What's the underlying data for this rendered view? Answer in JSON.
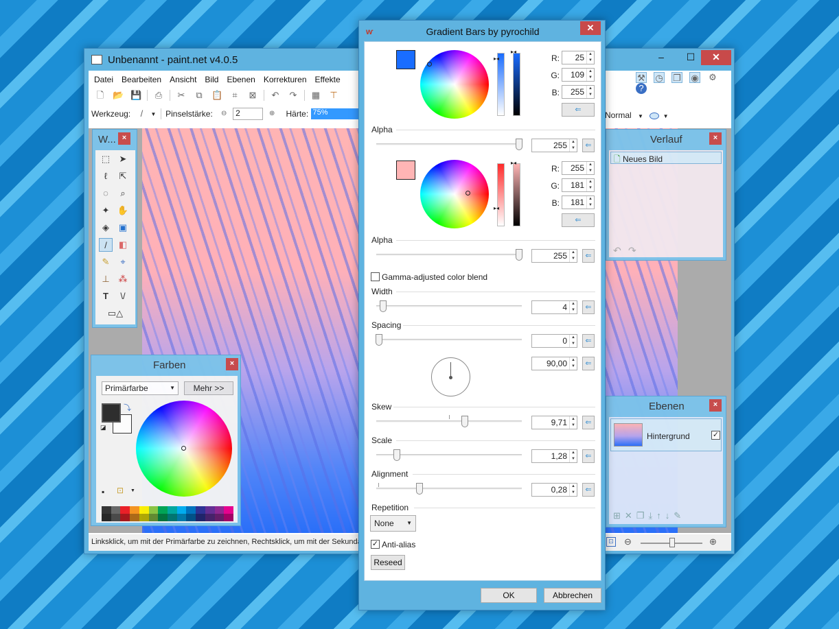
{
  "main_window": {
    "title": "Unbenannt - paint.net v4.0.5",
    "controls": {
      "minimize": "–",
      "maximize": "☐",
      "close": "✕"
    },
    "menu": [
      "Datei",
      "Bearbeiten",
      "Ansicht",
      "Bild",
      "Ebenen",
      "Korrekturen",
      "Effekte"
    ],
    "toolbar2": {
      "tool_label": "Werkzeug:",
      "brush_label": "Pinselstärke:",
      "brush_value": "2",
      "hardness_label": "Härte:",
      "hardness_value": "75%",
      "blend_mode": "Normal"
    },
    "status_text": "Linksklick, um mit der Primärfarbe zu zeichnen, Rechtsklick, um mit der Sekundärf"
  },
  "tools_palette": {
    "title": "W..."
  },
  "colors_palette": {
    "title": "Farben",
    "select_value": "Primärfarbe",
    "more_button": "Mehr >>",
    "palette_colors": [
      "#333333",
      "#666666",
      "#ed1c24",
      "#f7941d",
      "#fff200",
      "#8dc63f",
      "#00a651",
      "#00a99d",
      "#00aeef",
      "#0072bc",
      "#2e3192",
      "#662d91",
      "#92278f",
      "#ec008c"
    ]
  },
  "history_palette": {
    "title": "Verlauf",
    "items": [
      "Neues Bild"
    ]
  },
  "layers_palette": {
    "title": "Ebenen",
    "layers": [
      {
        "name": "Hintergrund",
        "visible": true
      }
    ]
  },
  "dialog": {
    "title": "Gradient Bars by pyrochild",
    "close": "✕",
    "color1": {
      "swatch": "#196dff",
      "r_label": "R:",
      "g_label": "G:",
      "b_label": "B:",
      "r": "25",
      "g": "109",
      "b": "255"
    },
    "alpha1": {
      "label": "Alpha",
      "value": "255",
      "fraction": 1.0
    },
    "color2": {
      "swatch": "#ffb5b5",
      "r_label": "R:",
      "g_label": "G:",
      "b_label": "B:",
      "r": "255",
      "g": "181",
      "b": "181"
    },
    "alpha2": {
      "label": "Alpha",
      "value": "255",
      "fraction": 1.0
    },
    "gamma_label": "Gamma-adjusted color blend",
    "gamma_checked": false,
    "width": {
      "label": "Width",
      "value": "4",
      "fraction": 0.04
    },
    "spacing": {
      "label": "Spacing",
      "value": "0",
      "fraction": 0.0
    },
    "angle": {
      "value": "90,00"
    },
    "skew": {
      "label": "Skew",
      "value": "9,71",
      "fraction": 0.6
    },
    "scale": {
      "label": "Scale",
      "value": "1,28",
      "fraction": 0.13
    },
    "alignment": {
      "label": "Alignment",
      "value": "0,28",
      "fraction": 0.28
    },
    "repetition": {
      "label": "Repetition",
      "value": "None"
    },
    "antialias": {
      "label": "Anti-alias",
      "checked": true
    },
    "reseed": "Reseed",
    "ok": "OK",
    "cancel": "Abbrechen"
  }
}
